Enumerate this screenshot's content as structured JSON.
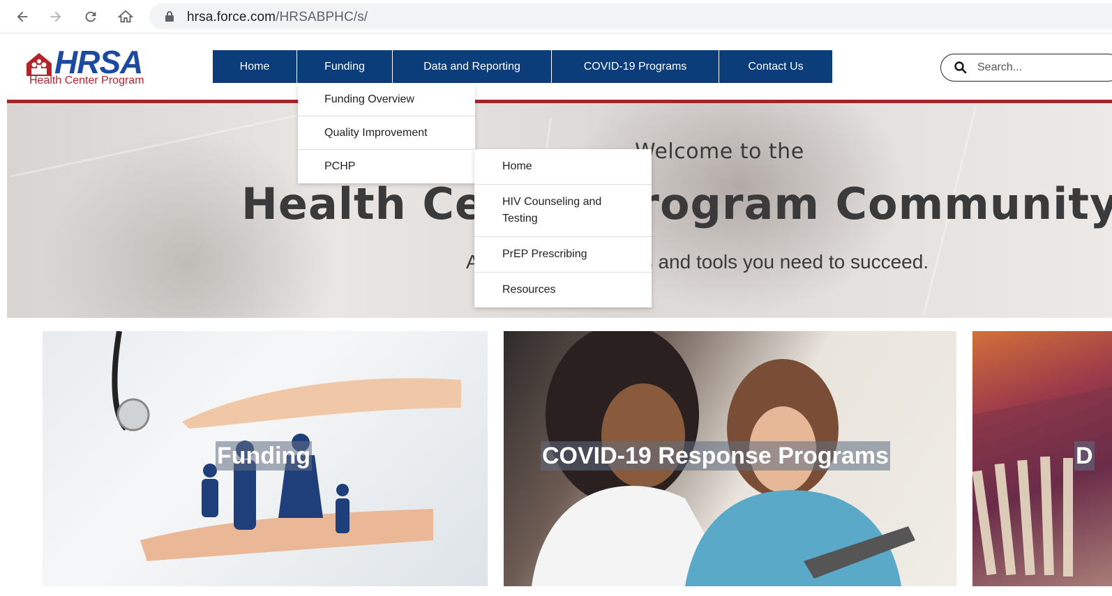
{
  "browser": {
    "url_host": "hrsa.force.com",
    "url_path": "/HRSABPHC/s/"
  },
  "logo": {
    "letters": "HRSA",
    "subtitle": "Health Center Program"
  },
  "nav": {
    "items": [
      {
        "label": "Home"
      },
      {
        "label": "Funding"
      },
      {
        "label": "Data and Reporting"
      },
      {
        "label": "COVID-19 Programs"
      },
      {
        "label": "Contact Us"
      }
    ]
  },
  "search": {
    "placeholder": "Search..."
  },
  "funding_menu": {
    "items": [
      {
        "label": "Funding Overview"
      },
      {
        "label": "Quality Improvement"
      },
      {
        "label": "PCHP"
      }
    ]
  },
  "pchp_menu": {
    "items": [
      {
        "label": "Home"
      },
      {
        "label": "HIV Counseling and Testing"
      },
      {
        "label": "PrEP Prescribing"
      },
      {
        "label": "Resources"
      }
    ]
  },
  "hero": {
    "welcome": "Welcome to the",
    "title": "Health Center Program Community",
    "tagline": "Access the resources and tools you need to succeed."
  },
  "cards": [
    {
      "label": "Funding"
    },
    {
      "label": "COVID-19 Response Programs"
    },
    {
      "label": "D"
    }
  ],
  "colors": {
    "nav_bg": "#0a3d7a",
    "brand_red": "#a3252a",
    "brand_blue": "#1b4aa0"
  }
}
